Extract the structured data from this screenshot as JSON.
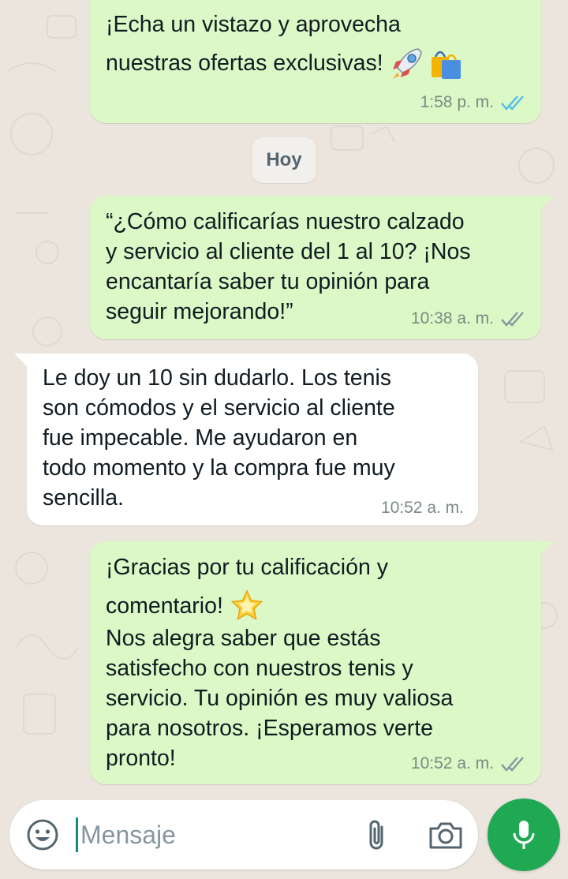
{
  "chat": {
    "date_separator": "Hoy",
    "messages": [
      {
        "direction": "out",
        "lines": [
          "¡Echa un vistazo y aprovecha",
          "nuestras ofertas exclusivas!"
        ],
        "emojis": [
          "rocket-emoji",
          "shopping-bags-emoji"
        ],
        "time": "1:58 p. m.",
        "status": "read",
        "status_color": "#53bdeb"
      },
      {
        "direction": "out",
        "text": "“¿Cómo calificarías nuestro calzado\ny servicio al cliente del 1 al 10? ¡Nos\nencantaría saber tu opinión para\nseguir mejorando!”",
        "time": "10:38 a. m.",
        "status": "delivered",
        "status_color": "#8696a0"
      },
      {
        "direction": "in",
        "text": "Le doy un 10 sin dudarlo. Los tenis\nson cómodos y el servicio al cliente\nfue impecable. Me ayudaron en\ntodo momento y la compra fue muy\nsencilla.",
        "time": "10:52 a. m."
      },
      {
        "direction": "out",
        "lines": [
          "¡Gracias por tu calificación y",
          "comentario!"
        ],
        "emojis": [
          "glowing-star-emoji"
        ],
        "text": "Nos alegra saber que estás\nsatisfecho con nuestros tenis y\nservicio. Tu opinión es muy valiosa\npara nosotros. ¡Esperamos verte\npronto!",
        "time": "10:52 a. m.",
        "status": "delivered",
        "status_color": "#8696a0"
      }
    ]
  },
  "input": {
    "placeholder": "Mensaje",
    "value": ""
  },
  "icons": {
    "emoji": "emoji-icon",
    "attach": "paperclip-icon",
    "camera": "camera-icon",
    "mic": "mic-icon"
  },
  "colors": {
    "outgoing_bubble": "#dcf8c6",
    "incoming_bubble": "#ffffff",
    "background": "#ece5dd",
    "accent": "#1ea952",
    "read_ticks": "#53bdeb"
  }
}
